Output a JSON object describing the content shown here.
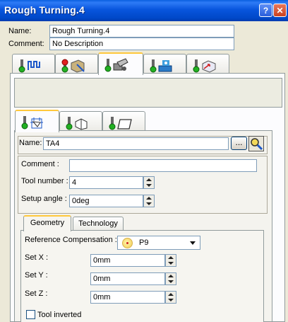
{
  "window": {
    "title": "Rough Turning.4",
    "help_glyph": "?",
    "close_glyph": "✕"
  },
  "operation": {
    "name_label": "Name:",
    "name_value": "Rough Turning.4",
    "comment_label": "Comment:",
    "comment_value": "No Description"
  },
  "main_tabs": [
    {
      "icon": "strategy-icon",
      "active": false
    },
    {
      "icon": "geometry-part-icon",
      "active": false
    },
    {
      "icon": "tool-assembly-icon",
      "active": true
    },
    {
      "icon": "feeds-speeds-icon",
      "active": false
    },
    {
      "icon": "macros-icon",
      "active": false
    }
  ],
  "sub_tabs": [
    {
      "icon": "tool-assembly-tab-icon",
      "active": true
    },
    {
      "icon": "insert-holder-icon",
      "active": false
    },
    {
      "icon": "insert-icon",
      "active": false
    }
  ],
  "tool": {
    "name_label": "Name:",
    "name_value": "TA4",
    "browse_label": "...",
    "comment_label": "Comment :",
    "comment_value": "",
    "tool_number_label": "Tool number :",
    "tool_number_value": "4",
    "setup_angle_label": "Setup angle :",
    "setup_angle_value": "0deg"
  },
  "inner_tabs": [
    {
      "label": "Geometry",
      "active": true
    },
    {
      "label": "Technology",
      "active": false
    }
  ],
  "geometry": {
    "ref_comp_label": "Reference Compensation :",
    "ref_comp_value": "P9",
    "set_x_label": "Set X :",
    "set_x_value": "0mm",
    "set_y_label": "Set Y :",
    "set_y_value": "0mm",
    "set_z_label": "Set Z :",
    "set_z_value": "0mm",
    "tool_inverted_label": "Tool inverted",
    "tool_inverted_checked": false
  },
  "colors": {
    "titlebar": "#0055E5",
    "dialog_bg": "#ECE9D8",
    "tab_highlight": "#FFC83C",
    "status_green": "#22B022",
    "status_red": "#E02020"
  }
}
